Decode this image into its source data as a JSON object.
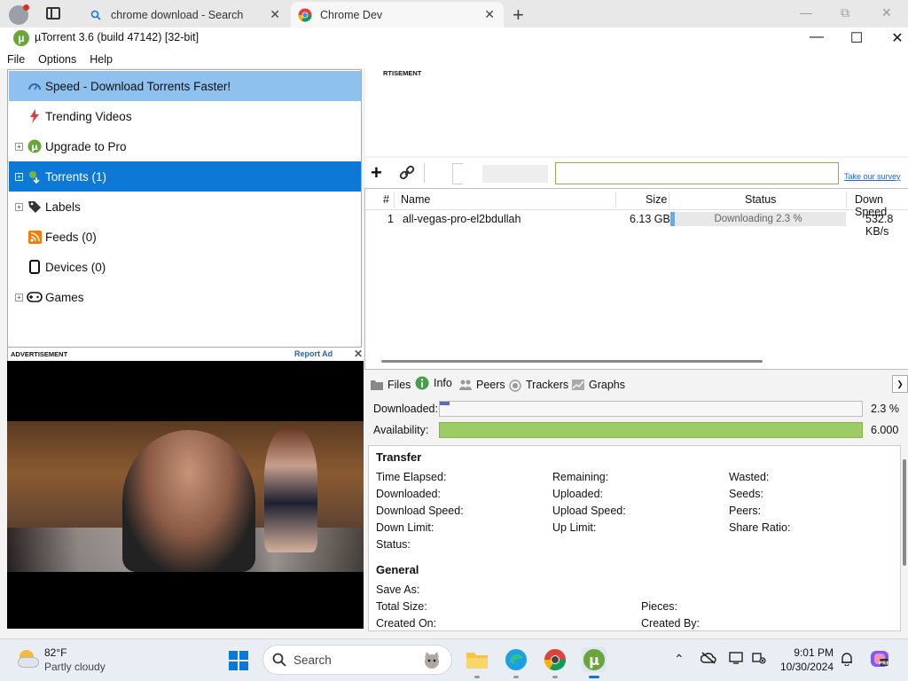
{
  "browser": {
    "tabs": [
      {
        "title": "chrome download - Search"
      },
      {
        "title": "Chrome Dev"
      }
    ],
    "new_tab": "+",
    "min": "—",
    "restore": "⧉",
    "close": "✕"
  },
  "app": {
    "title": "µTorrent 3.6  (build 47142) [32-bit]",
    "menu": [
      "File",
      "Options",
      "Help"
    ]
  },
  "sidebar": {
    "items": [
      {
        "label": "Speed - Download Torrents Faster!"
      },
      {
        "label": "Trending Videos"
      },
      {
        "label": "Upgrade to Pro"
      },
      {
        "label": "Torrents (1)"
      },
      {
        "label": "Labels"
      },
      {
        "label": "Feeds (0)"
      },
      {
        "label": "Devices (0)"
      },
      {
        "label": "Games"
      }
    ]
  },
  "ad_left": {
    "label": "ADVERTISEMENT",
    "report": "Report Ad",
    "close": "✕"
  },
  "ad_right": {
    "label": "RTISEMENT"
  },
  "toolbar": {
    "survey": "Take our survey"
  },
  "torrents": {
    "columns": [
      "#",
      "Name",
      "Size",
      "Status",
      "Down Speed"
    ],
    "rows": [
      {
        "num": "1",
        "name": "all-vegas-pro-el2bdullah",
        "size": "6.13 GB",
        "status": "Downloading 2.3 %",
        "progress": 0.023,
        "down": "532.8 KB/s"
      }
    ]
  },
  "details": {
    "tabs": [
      "Files",
      "Info",
      "Peers",
      "Trackers",
      "Graphs"
    ],
    "downloaded_label": "Downloaded:",
    "downloaded_value": "2.3 %",
    "availability_label": "Availability:",
    "availability_value": "6.000",
    "transfer": {
      "heading": "Transfer",
      "fields": [
        "Time Elapsed:",
        "Remaining:",
        "Wasted:",
        "Downloaded:",
        "Uploaded:",
        "Seeds:",
        "Download Speed:",
        "Upload Speed:",
        "Peers:",
        "Down Limit:",
        "Up Limit:",
        "Share Ratio:",
        "Status:"
      ]
    },
    "general": {
      "heading": "General",
      "fields": [
        "Save As:",
        "Total Size:",
        "Pieces:",
        "Created On:",
        "Created By:"
      ]
    }
  },
  "taskbar": {
    "temp": "82°F",
    "weather": "Partly cloudy",
    "search_placeholder": "Search",
    "time": "9:01 PM",
    "date": "10/30/2024"
  },
  "colors": {
    "selected": "#0d78d6",
    "hover": "#8ec1ee",
    "progress": "#6fa8dc",
    "availability": "#9ccc65",
    "utorrent": "#6aa53b"
  }
}
